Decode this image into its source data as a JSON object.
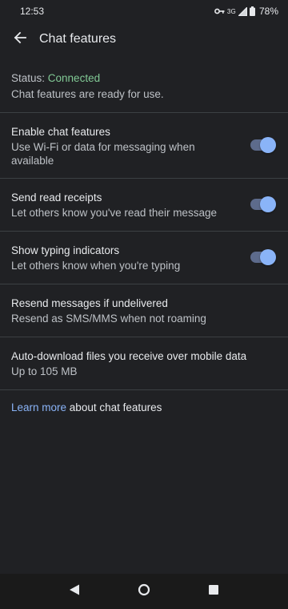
{
  "status_bar": {
    "time": "12:53",
    "network_type": "3G",
    "battery": "78%"
  },
  "app_bar": {
    "title": "Chat features"
  },
  "status": {
    "label": "Status: ",
    "value": "Connected",
    "description": "Chat features are ready for use.",
    "value_color": "#81c995"
  },
  "settings": [
    {
      "title": "Enable chat features",
      "subtitle": "Use Wi-Fi or data for messaging when available",
      "toggle": true
    },
    {
      "title": "Send read receipts",
      "subtitle": "Let others know you've read their message",
      "toggle": true
    },
    {
      "title": "Show typing indicators",
      "subtitle": "Let others know when you're typing",
      "toggle": true
    },
    {
      "title": "Resend messages if undelivered",
      "subtitle": "Resend as SMS/MMS when not roaming",
      "toggle": false
    },
    {
      "title": "Auto-download files you receive over mobile data",
      "subtitle": "Up to 105 MB",
      "toggle": false
    }
  ],
  "learn_more": {
    "link_text": "Learn more",
    "rest_text": " about chat features"
  },
  "colors": {
    "background": "#202124",
    "accent": "#8ab4f8",
    "connected": "#81c995"
  },
  "icons": {
    "back": "arrow-back-icon",
    "nav_back": "triangle-back-icon",
    "nav_home": "circle-home-icon",
    "nav_recents": "square-recents-icon"
  }
}
